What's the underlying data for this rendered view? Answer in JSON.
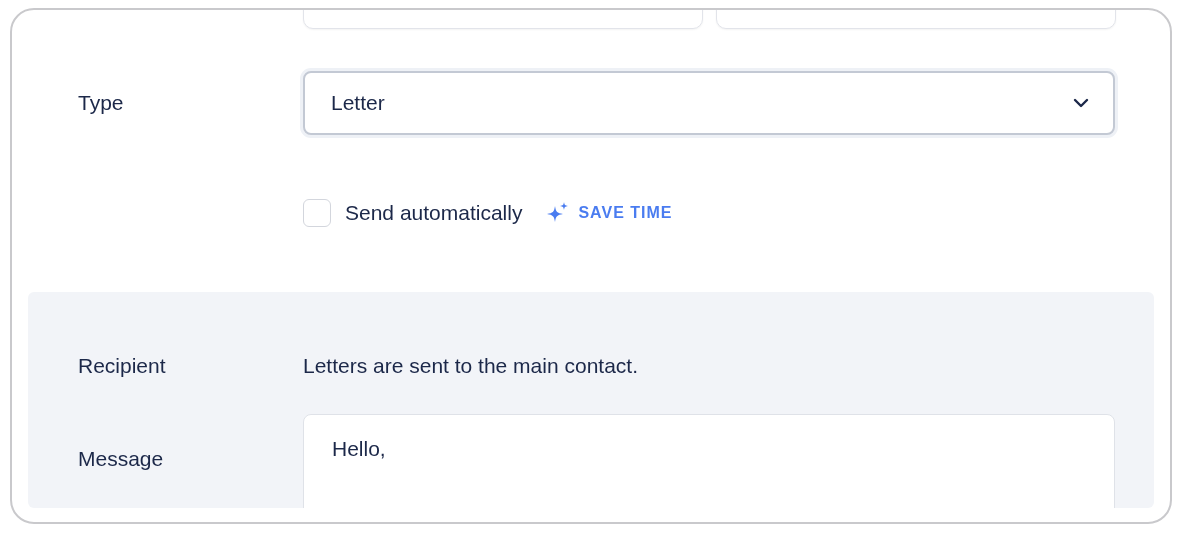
{
  "type_field": {
    "label": "Type",
    "value": "Letter"
  },
  "send_automatically": {
    "label": "Send automatically",
    "checked": false,
    "hint": "SAVE TIME"
  },
  "recipient": {
    "label": "Recipient",
    "text": "Letters are sent to the main contact."
  },
  "message": {
    "label": "Message",
    "value": "Hello,"
  }
}
